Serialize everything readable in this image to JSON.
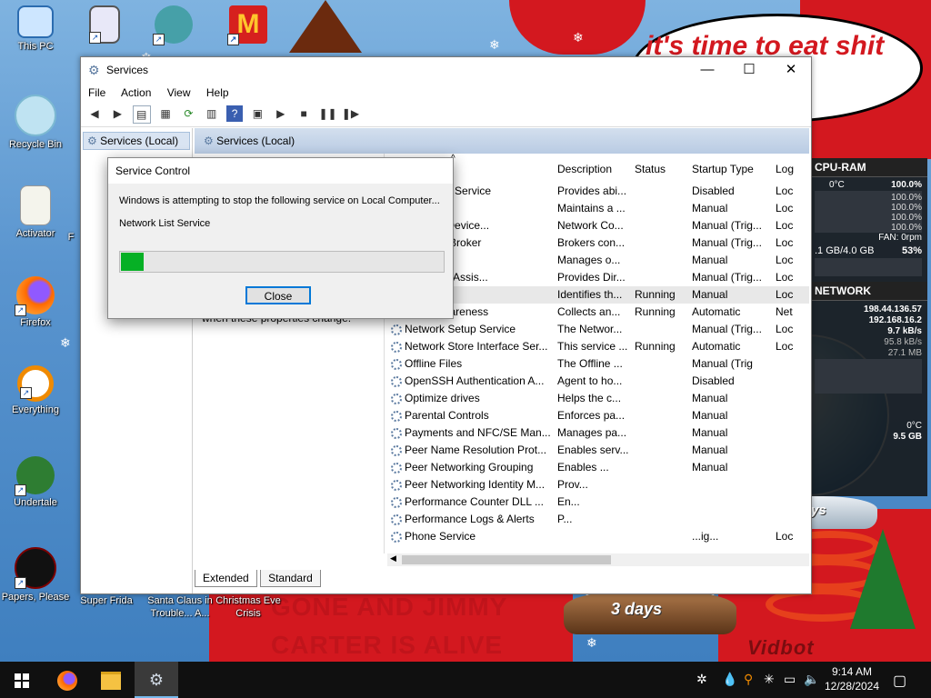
{
  "desktop": {
    "icons": [
      {
        "label": "This PC",
        "icon": "monitor-icon"
      },
      {
        "label": "",
        "icon": "app-icon"
      },
      {
        "label": "",
        "icon": "game-character-icon"
      },
      {
        "label": "",
        "icon": "mcdonalds-icon"
      },
      {
        "label": "Recycle Bin",
        "icon": "recycle-bin-icon"
      },
      {
        "label": "Activator",
        "icon": "activator-icon"
      },
      {
        "label": "Firefox",
        "icon": "firefox-icon"
      },
      {
        "label": "Everything",
        "icon": "everything-search-icon"
      },
      {
        "label": "Undertale",
        "icon": "undertale-icon"
      },
      {
        "label": "Papers, Please",
        "icon": "papers-please-icon"
      },
      {
        "label": "Super Frida",
        "icon": "game-icon"
      },
      {
        "label": "Santa Claus in Trouble... A...",
        "icon": "game-icon"
      },
      {
        "label": "Christmas Eve Crisis",
        "icon": "game-icon"
      },
      {
        "label": "F",
        "icon": "app-icon"
      }
    ],
    "wallpaper": {
      "bubble_text": "it's time to eat shit chew s",
      "bottom_text_1": "GONE AND JIMMY",
      "bottom_text_2": "CARTER IS ALIVE",
      "globe_label": "3 days",
      "signature": "Vidbot"
    }
  },
  "sysmon": {
    "cpu_header": "CPU-RAM",
    "temp": "0°C",
    "cpu_pct": "100.0%",
    "cores": [
      "100.0%",
      "100.0%",
      "100.0%",
      "100.0%"
    ],
    "fan": "FAN: 0rpm",
    "ram": ".1 GB/4.0 GB",
    "ram_pct": "53%",
    "net_header": "NETWORK",
    "ip1": "198.44.136.57",
    "ip2": "192.168.16.2",
    "speed1": "9.7 kB/s",
    "speed2": "95.8 kB/s",
    "total": "27.1 MB",
    "temp2": "0°C",
    "disk": "9.5 GB"
  },
  "services_window": {
    "title": "Services",
    "menu": [
      "File",
      "Action",
      "View",
      "Help"
    ],
    "tree_node": "Services (Local)",
    "main_header": "Services (Local)",
    "desc_text": "when these properties change.",
    "columns": {
      "name": "Name",
      "description": "Description",
      "status": "Status",
      "startup": "Startup Type",
      "logon": "Log"
    },
    "rows": [
      {
        "name": "Port Sharing Service",
        "desc": "Provides abi...",
        "status": "",
        "startup": "Disabled",
        "logon": "Loc"
      },
      {
        "name": "",
        "desc": "Maintains a ...",
        "status": "",
        "startup": "Manual",
        "logon": "Loc"
      },
      {
        "name": "Connected Device...",
        "desc": "Network Co...",
        "status": "",
        "startup": "Manual (Trig...",
        "logon": "Loc"
      },
      {
        "name": "Connection Broker",
        "desc": "Brokers con...",
        "status": "",
        "startup": "Manual (Trig...",
        "logon": "Loc"
      },
      {
        "name": "Connections",
        "desc": "Manages o...",
        "status": "",
        "startup": "Manual",
        "logon": "Loc"
      },
      {
        "name": "Connectivity Assis...",
        "desc": "Provides Dir...",
        "status": "",
        "startup": "Manual (Trig...",
        "logon": "Loc"
      },
      {
        "name": "List Service",
        "desc": "Identifies th...",
        "status": "Running",
        "startup": "Manual",
        "logon": "Loc"
      },
      {
        "name": "Location Awareness",
        "desc": "Collects an...",
        "status": "Running",
        "startup": "Automatic",
        "logon": "Net"
      },
      {
        "name": "Network Setup Service",
        "desc": "The Networ...",
        "status": "",
        "startup": "Manual (Trig...",
        "logon": "Loc"
      },
      {
        "name": "Network Store Interface Ser...",
        "desc": "This service ...",
        "status": "Running",
        "startup": "Automatic",
        "logon": "Loc"
      },
      {
        "name": "Offline Files",
        "desc": "The Offline ...",
        "status": "",
        "startup": "Manual (Trig",
        "logon": ""
      },
      {
        "name": "OpenSSH Authentication A...",
        "desc": "Agent to ho...",
        "status": "",
        "startup": "Disabled",
        "logon": ""
      },
      {
        "name": "Optimize drives",
        "desc": "Helps the c...",
        "status": "",
        "startup": "Manual",
        "logon": ""
      },
      {
        "name": "Parental Controls",
        "desc": "Enforces pa...",
        "status": "",
        "startup": "Manual",
        "logon": ""
      },
      {
        "name": "Payments and NFC/SE Man...",
        "desc": "Manages pa...",
        "status": "",
        "startup": "Manual",
        "logon": ""
      },
      {
        "name": "Peer Name Resolution Prot...",
        "desc": "Enables serv...",
        "status": "",
        "startup": "Manual",
        "logon": ""
      },
      {
        "name": "Peer Networking Grouping",
        "desc": "Enables ...",
        "status": "",
        "startup": "Manual",
        "logon": ""
      },
      {
        "name": "Peer Networking Identity M...",
        "desc": "Prov...",
        "status": "",
        "startup": "",
        "logon": ""
      },
      {
        "name": "Performance Counter DLL ...",
        "desc": "En...",
        "status": "",
        "startup": "",
        "logon": ""
      },
      {
        "name": "Performance Logs & Alerts",
        "desc": "P...",
        "status": "",
        "startup": "",
        "logon": ""
      },
      {
        "name": "Phone Service",
        "desc": "",
        "status": "",
        "startup": "...ig...",
        "logon": "Loc"
      }
    ],
    "tabs": [
      "Extended",
      "Standard"
    ]
  },
  "dialog": {
    "title": "Service Control",
    "message": "Windows is attempting to stop the following service on Local Computer...",
    "service": "Network List Service",
    "progress": 0.07,
    "close_label": "Close"
  },
  "taskbar": {
    "time": "9:14 AM",
    "date": "12/28/2024"
  }
}
